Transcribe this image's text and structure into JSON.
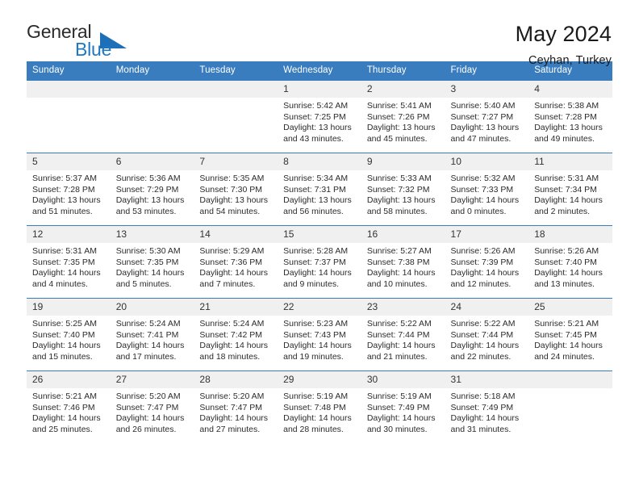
{
  "logo": {
    "primary_text": "General",
    "secondary_text": "Blue",
    "accent_color": "#1d78c1"
  },
  "header": {
    "title": "May 2024",
    "subtitle": "Ceyhan, Turkey"
  },
  "colors": {
    "header_blue": "#3a7dbf",
    "daynum_background": "#f0f0f0",
    "text": "#2b2b2b"
  },
  "weekday_headers": [
    "Sunday",
    "Monday",
    "Tuesday",
    "Wednesday",
    "Thursday",
    "Friday",
    "Saturday"
  ],
  "weeks": [
    [
      {
        "day": "",
        "empty": true
      },
      {
        "day": "",
        "empty": true
      },
      {
        "day": "",
        "empty": true
      },
      {
        "day": "1",
        "sunrise": "Sunrise: 5:42 AM",
        "sunset": "Sunset: 7:25 PM",
        "daylight": "Daylight: 13 hours and 43 minutes."
      },
      {
        "day": "2",
        "sunrise": "Sunrise: 5:41 AM",
        "sunset": "Sunset: 7:26 PM",
        "daylight": "Daylight: 13 hours and 45 minutes."
      },
      {
        "day": "3",
        "sunrise": "Sunrise: 5:40 AM",
        "sunset": "Sunset: 7:27 PM",
        "daylight": "Daylight: 13 hours and 47 minutes."
      },
      {
        "day": "4",
        "sunrise": "Sunrise: 5:38 AM",
        "sunset": "Sunset: 7:28 PM",
        "daylight": "Daylight: 13 hours and 49 minutes."
      }
    ],
    [
      {
        "day": "5",
        "sunrise": "Sunrise: 5:37 AM",
        "sunset": "Sunset: 7:28 PM",
        "daylight": "Daylight: 13 hours and 51 minutes."
      },
      {
        "day": "6",
        "sunrise": "Sunrise: 5:36 AM",
        "sunset": "Sunset: 7:29 PM",
        "daylight": "Daylight: 13 hours and 53 minutes."
      },
      {
        "day": "7",
        "sunrise": "Sunrise: 5:35 AM",
        "sunset": "Sunset: 7:30 PM",
        "daylight": "Daylight: 13 hours and 54 minutes."
      },
      {
        "day": "8",
        "sunrise": "Sunrise: 5:34 AM",
        "sunset": "Sunset: 7:31 PM",
        "daylight": "Daylight: 13 hours and 56 minutes."
      },
      {
        "day": "9",
        "sunrise": "Sunrise: 5:33 AM",
        "sunset": "Sunset: 7:32 PM",
        "daylight": "Daylight: 13 hours and 58 minutes."
      },
      {
        "day": "10",
        "sunrise": "Sunrise: 5:32 AM",
        "sunset": "Sunset: 7:33 PM",
        "daylight": "Daylight: 14 hours and 0 minutes."
      },
      {
        "day": "11",
        "sunrise": "Sunrise: 5:31 AM",
        "sunset": "Sunset: 7:34 PM",
        "daylight": "Daylight: 14 hours and 2 minutes."
      }
    ],
    [
      {
        "day": "12",
        "sunrise": "Sunrise: 5:31 AM",
        "sunset": "Sunset: 7:35 PM",
        "daylight": "Daylight: 14 hours and 4 minutes."
      },
      {
        "day": "13",
        "sunrise": "Sunrise: 5:30 AM",
        "sunset": "Sunset: 7:35 PM",
        "daylight": "Daylight: 14 hours and 5 minutes."
      },
      {
        "day": "14",
        "sunrise": "Sunrise: 5:29 AM",
        "sunset": "Sunset: 7:36 PM",
        "daylight": "Daylight: 14 hours and 7 minutes."
      },
      {
        "day": "15",
        "sunrise": "Sunrise: 5:28 AM",
        "sunset": "Sunset: 7:37 PM",
        "daylight": "Daylight: 14 hours and 9 minutes."
      },
      {
        "day": "16",
        "sunrise": "Sunrise: 5:27 AM",
        "sunset": "Sunset: 7:38 PM",
        "daylight": "Daylight: 14 hours and 10 minutes."
      },
      {
        "day": "17",
        "sunrise": "Sunrise: 5:26 AM",
        "sunset": "Sunset: 7:39 PM",
        "daylight": "Daylight: 14 hours and 12 minutes."
      },
      {
        "day": "18",
        "sunrise": "Sunrise: 5:26 AM",
        "sunset": "Sunset: 7:40 PM",
        "daylight": "Daylight: 14 hours and 13 minutes."
      }
    ],
    [
      {
        "day": "19",
        "sunrise": "Sunrise: 5:25 AM",
        "sunset": "Sunset: 7:40 PM",
        "daylight": "Daylight: 14 hours and 15 minutes."
      },
      {
        "day": "20",
        "sunrise": "Sunrise: 5:24 AM",
        "sunset": "Sunset: 7:41 PM",
        "daylight": "Daylight: 14 hours and 17 minutes."
      },
      {
        "day": "21",
        "sunrise": "Sunrise: 5:24 AM",
        "sunset": "Sunset: 7:42 PM",
        "daylight": "Daylight: 14 hours and 18 minutes."
      },
      {
        "day": "22",
        "sunrise": "Sunrise: 5:23 AM",
        "sunset": "Sunset: 7:43 PM",
        "daylight": "Daylight: 14 hours and 19 minutes."
      },
      {
        "day": "23",
        "sunrise": "Sunrise: 5:22 AM",
        "sunset": "Sunset: 7:44 PM",
        "daylight": "Daylight: 14 hours and 21 minutes."
      },
      {
        "day": "24",
        "sunrise": "Sunrise: 5:22 AM",
        "sunset": "Sunset: 7:44 PM",
        "daylight": "Daylight: 14 hours and 22 minutes."
      },
      {
        "day": "25",
        "sunrise": "Sunrise: 5:21 AM",
        "sunset": "Sunset: 7:45 PM",
        "daylight": "Daylight: 14 hours and 24 minutes."
      }
    ],
    [
      {
        "day": "26",
        "sunrise": "Sunrise: 5:21 AM",
        "sunset": "Sunset: 7:46 PM",
        "daylight": "Daylight: 14 hours and 25 minutes."
      },
      {
        "day": "27",
        "sunrise": "Sunrise: 5:20 AM",
        "sunset": "Sunset: 7:47 PM",
        "daylight": "Daylight: 14 hours and 26 minutes."
      },
      {
        "day": "28",
        "sunrise": "Sunrise: 5:20 AM",
        "sunset": "Sunset: 7:47 PM",
        "daylight": "Daylight: 14 hours and 27 minutes."
      },
      {
        "day": "29",
        "sunrise": "Sunrise: 5:19 AM",
        "sunset": "Sunset: 7:48 PM",
        "daylight": "Daylight: 14 hours and 28 minutes."
      },
      {
        "day": "30",
        "sunrise": "Sunrise: 5:19 AM",
        "sunset": "Sunset: 7:49 PM",
        "daylight": "Daylight: 14 hours and 30 minutes."
      },
      {
        "day": "31",
        "sunrise": "Sunrise: 5:18 AM",
        "sunset": "Sunset: 7:49 PM",
        "daylight": "Daylight: 14 hours and 31 minutes."
      },
      {
        "day": "",
        "empty": true
      }
    ]
  ]
}
